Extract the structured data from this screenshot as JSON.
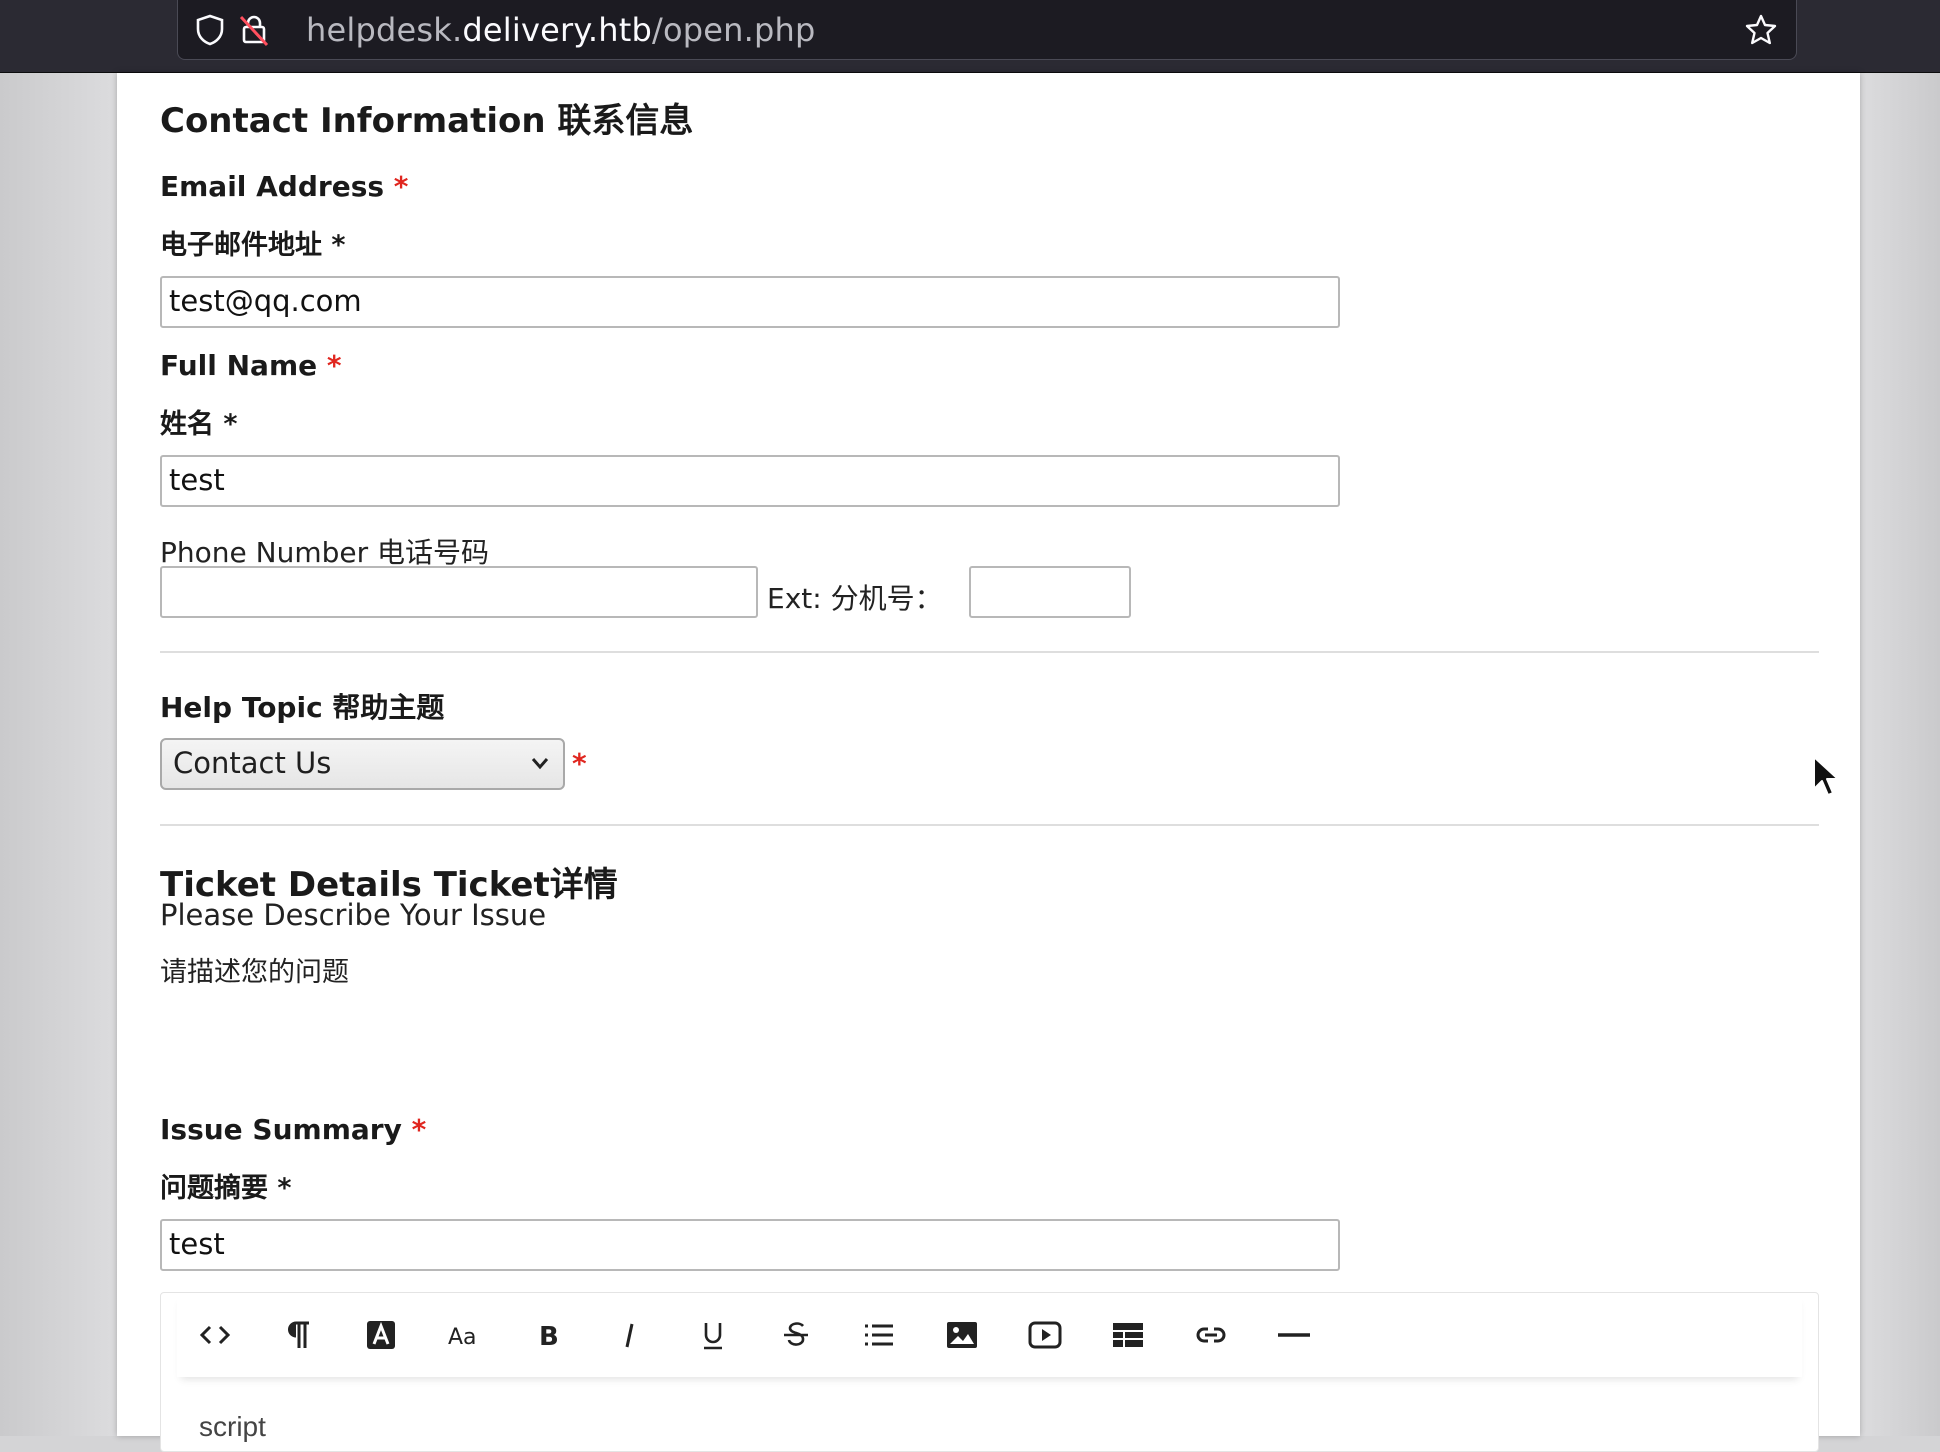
{
  "browser": {
    "url_prefix": "helpdesk.",
    "url_host": "delivery.htb",
    "url_path": "/open.php",
    "icons": [
      "shield-icon",
      "insecure-lock-icon",
      "bookmark-star-icon"
    ]
  },
  "contact": {
    "title": "Contact Information 联系信息",
    "email": {
      "label": "Email Address",
      "required": "*",
      "sub_label": "电子邮件地址 *",
      "value": "test@qq.com"
    },
    "name": {
      "label": "Full Name",
      "required": "*",
      "sub_label": "姓名 *",
      "value": "test"
    },
    "phone": {
      "label": "Phone Number  电话号码",
      "value": "",
      "ext_label": "Ext:  分机号：",
      "ext_value": ""
    }
  },
  "help_topic": {
    "label": "Help Topic 帮助主题",
    "selected": "Contact Us",
    "required": "*"
  },
  "ticket": {
    "title": "Ticket Details Ticket详情",
    "instructions": "Please Describe Your Issue",
    "instructions_cn": "请描述您的问题",
    "summary": {
      "label": "Issue Summary",
      "required": "*",
      "sub_label": "问题摘要 *",
      "value": "test"
    }
  },
  "editor": {
    "toolbar": [
      "code-view",
      "paragraph",
      "text-color",
      "font-size",
      "bold",
      "italic",
      "underline",
      "strikethrough",
      "list",
      "image",
      "video",
      "table",
      "link",
      "horizontal-rule"
    ],
    "content": "script"
  },
  "colors": {
    "required": "#e0261f",
    "chrome": "#2b2a33",
    "urlbar": "#1c1b22"
  }
}
